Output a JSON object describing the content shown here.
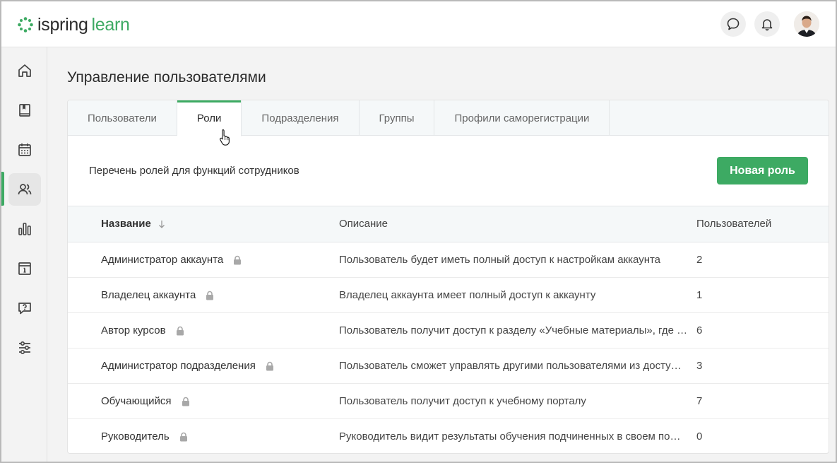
{
  "brand": {
    "name_part1": "ispring",
    "name_part2": "learn",
    "accent": "#3daa63"
  },
  "header": {
    "chat_icon": "chat-bubble-icon",
    "bell_icon": "bell-icon",
    "avatar_icon": "user-avatar"
  },
  "sidebar": {
    "items": [
      {
        "icon": "home-icon"
      },
      {
        "icon": "book-icon"
      },
      {
        "icon": "calendar-icon"
      },
      {
        "icon": "users-icon",
        "active": true
      },
      {
        "icon": "bar-chart-icon"
      },
      {
        "icon": "info-board-icon"
      },
      {
        "icon": "question-chat-icon"
      },
      {
        "icon": "sliders-icon"
      }
    ]
  },
  "page": {
    "title": "Управление пользователями",
    "tabs": [
      {
        "label": "Пользователи"
      },
      {
        "label": "Роли",
        "active": true
      },
      {
        "label": "Подразделения"
      },
      {
        "label": "Группы"
      },
      {
        "label": "Профили саморегистрации"
      }
    ],
    "intro": "Перечень ролей для функций сотрудников",
    "new_role_button": "Новая роль"
  },
  "table": {
    "headers": {
      "name": "Название",
      "description": "Описание",
      "users": "Пользователей"
    },
    "rows": [
      {
        "name": "Администратор аккаунта",
        "description": "Пользователь будет иметь полный доступ к настройкам аккаунта",
        "users": "2"
      },
      {
        "name": "Владелец аккаунта",
        "description": "Владелец аккаунта имеет полный доступ к аккаунту",
        "users": "1"
      },
      {
        "name": "Автор курсов",
        "description": "Пользователь получит доступ к разделу «Учебные материалы», где …",
        "users": "6"
      },
      {
        "name": "Администратор подразделения",
        "description": "Пользователь сможет управлять другими пользователями из досту…",
        "users": "3"
      },
      {
        "name": "Обучающийся",
        "description": "Пользователь получит доступ к учебному порталу",
        "users": "7"
      },
      {
        "name": "Руководитель",
        "description": "Руководитель видит результаты обучения подчиненных в своем по…",
        "users": "0"
      }
    ]
  }
}
